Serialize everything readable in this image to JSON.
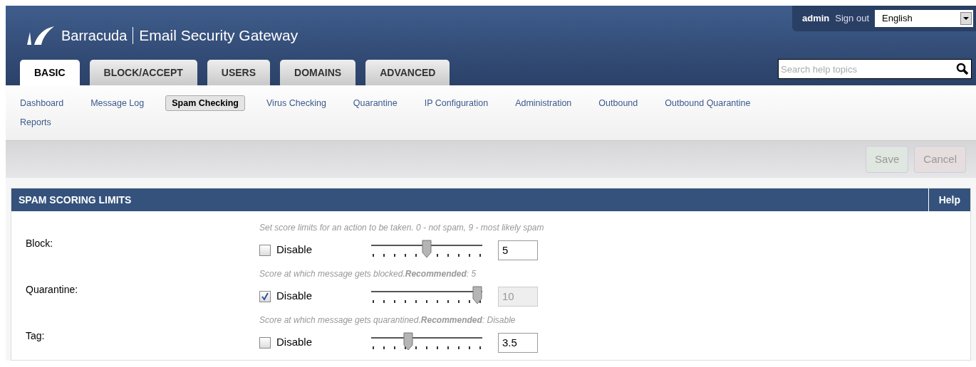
{
  "header": {
    "brand": "Barracuda",
    "product": "Email Security Gateway",
    "user": "admin",
    "sign_out": "Sign out",
    "language": "English",
    "search": {
      "placeholder": "Search help topics"
    }
  },
  "tabs": [
    {
      "label": "BASIC",
      "selected": true
    },
    {
      "label": "BLOCK/ACCEPT",
      "selected": false
    },
    {
      "label": "USERS",
      "selected": false
    },
    {
      "label": "DOMAINS",
      "selected": false
    },
    {
      "label": "ADVANCED",
      "selected": false
    }
  ],
  "subnav": [
    {
      "label": "Dashboard",
      "selected": false
    },
    {
      "label": "Message Log",
      "selected": false
    },
    {
      "label": "Spam Checking",
      "selected": true
    },
    {
      "label": "Virus Checking",
      "selected": false
    },
    {
      "label": "Quarantine",
      "selected": false
    },
    {
      "label": "IP Configuration",
      "selected": false
    },
    {
      "label": "Administration",
      "selected": false
    },
    {
      "label": "Outbound",
      "selected": false
    },
    {
      "label": "Outbound Quarantine",
      "selected": false
    },
    {
      "label": "Reports",
      "selected": false
    }
  ],
  "toolbar": {
    "buttons": [
      {
        "label": "Save",
        "disabled": true
      },
      {
        "label": "Cancel",
        "disabled": true
      }
    ]
  },
  "panel": {
    "title": "SPAM SCORING LIMITS",
    "help": "Help",
    "intro": "Set score limits for an action to be taken. 0 - not spam, 9 - most likely spam",
    "rows": [
      {
        "label": "Block:",
        "checkbox": "Disable",
        "checked": false,
        "level": 0.5,
        "value": "5",
        "note": "Score at which message gets blocked.**Recommended**: 5"
      },
      {
        "label": "Quarantine:",
        "checkbox": "Disable",
        "checked": true,
        "level": 1,
        "value": "10",
        "note": "Score at which message gets quarantined.**Recommended**: Disable"
      },
      {
        "label": "Tag:",
        "checkbox": "Disable",
        "checked": false,
        "level": 0.32,
        "value": "3.5"
      }
    ]
  }
}
